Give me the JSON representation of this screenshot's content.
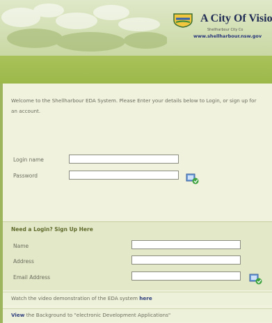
{
  "brand": {
    "title": "A City Of Visio",
    "subtitle": "Shellharbour City Co",
    "url": "www.shellharbour.nsw.gov"
  },
  "intro": {
    "text": "Welcome to the Shellharbour EDA System. Please Enter your details below to Login, or sign up for an account."
  },
  "login": {
    "name_label": "Login name",
    "password_label": "Password",
    "name_value": "",
    "password_value": ""
  },
  "signup": {
    "heading": "Need a Login? Sign Up Here",
    "name_label": "Name",
    "address_label": "Address",
    "email_label": "Email Address"
  },
  "links": {
    "demo_text": "Watch the video demonstration of the EDA system",
    "demo_link": "here",
    "background_link": "View",
    "background_text": "the Background to \"electronic Development Applications\""
  }
}
